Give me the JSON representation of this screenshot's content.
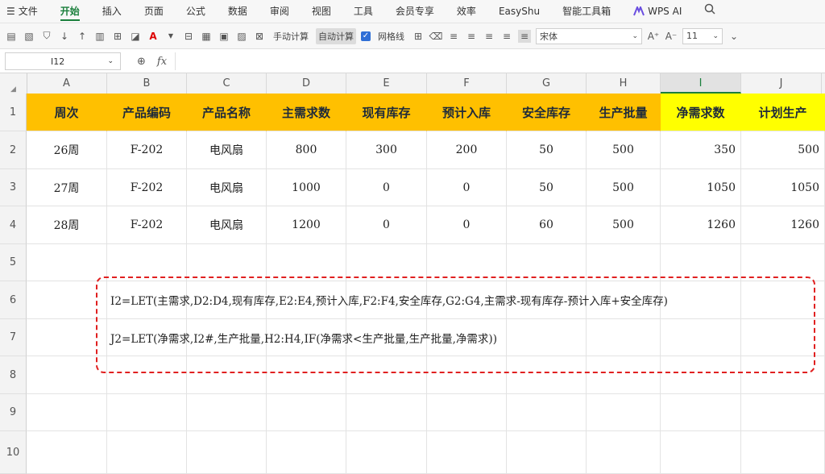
{
  "menu": {
    "file": "文件",
    "tabs": [
      "开始",
      "插入",
      "页面",
      "公式",
      "数据",
      "审阅",
      "视图",
      "工具",
      "会员专享",
      "效率",
      "EasyShu",
      "智能工具箱"
    ],
    "active": "开始",
    "wps_ai": "WPS AI"
  },
  "toolbar": {
    "manual_calc": "手动计算",
    "auto_calc": "自动计算",
    "gridlines": "网格线",
    "font_name": "宋体",
    "font_size": "11"
  },
  "formula_bar": {
    "cell_ref": "I12",
    "fx": "fx"
  },
  "columns": [
    "A",
    "B",
    "C",
    "D",
    "E",
    "F",
    "G",
    "H",
    "I",
    "J"
  ],
  "selected_column": "I",
  "rows": [
    "1",
    "2",
    "3",
    "4",
    "5",
    "6",
    "7",
    "8",
    "9",
    "10"
  ],
  "table": {
    "headers": [
      "周次",
      "产品编码",
      "产品名称",
      "主需求数",
      "现有库存",
      "预计入库",
      "安全库存",
      "生产批量",
      "净需求数",
      "计划生产"
    ],
    "data": [
      [
        "26周",
        "F-202",
        "电风扇",
        "800",
        "300",
        "200",
        "50",
        "500",
        "350",
        "500"
      ],
      [
        "27周",
        "F-202",
        "电风扇",
        "1000",
        "0",
        "0",
        "50",
        "500",
        "1050",
        "1050"
      ],
      [
        "28周",
        "F-202",
        "电风扇",
        "1200",
        "0",
        "0",
        "60",
        "500",
        "1260",
        "1260"
      ]
    ]
  },
  "notes": {
    "formula1": "I2=LET(主需求,D2:D4,现有库存,E2:E4,预计入库,F2:F4,安全库存,G2:G4,主需求-现有库存-预计入库+安全库存)",
    "formula2": "J2=LET(净需求,I2#,生产批量,H2:H4,IF(净需求<生产批量,生产批量,净需求))"
  },
  "colors": {
    "header_orange": "#FFC000",
    "header_yellow": "#FFFF00",
    "accent_green": "#1a7f3c",
    "dashed_red": "#e02020"
  }
}
